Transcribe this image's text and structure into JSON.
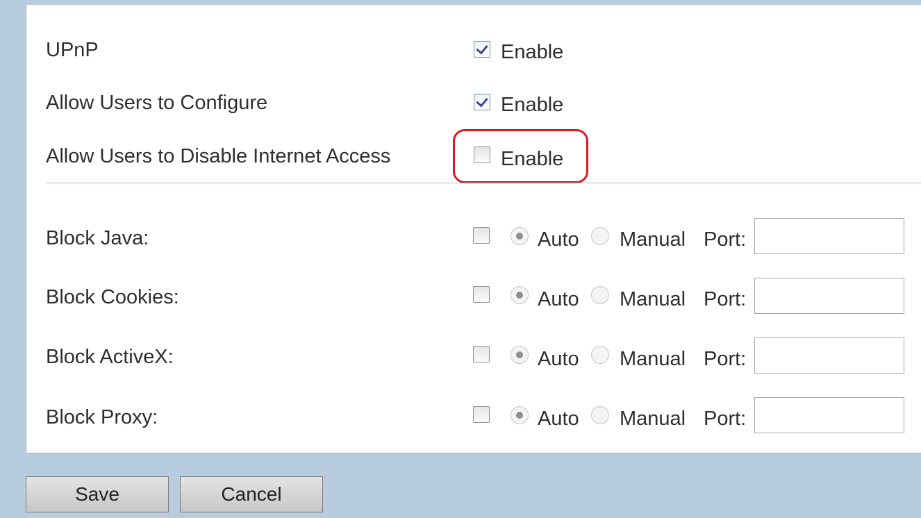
{
  "settings": [
    {
      "label": "UPnP",
      "enable_label": "Enable",
      "checked": true
    },
    {
      "label": "Allow Users to Configure",
      "enable_label": "Enable",
      "checked": true
    },
    {
      "label": "Allow Users to Disable Internet Access",
      "enable_label": "Enable",
      "checked": false
    }
  ],
  "blocks": [
    {
      "label": "Block Java:",
      "auto_label": "Auto",
      "manual_label": "Manual",
      "port_label": "Port:",
      "port_value": ""
    },
    {
      "label": "Block Cookies:",
      "auto_label": "Auto",
      "manual_label": "Manual",
      "port_label": "Port:",
      "port_value": ""
    },
    {
      "label": "Block ActiveX:",
      "auto_label": "Auto",
      "manual_label": "Manual",
      "port_label": "Port:",
      "port_value": ""
    },
    {
      "label": "Block Proxy:",
      "auto_label": "Auto",
      "manual_label": "Manual",
      "port_label": "Port:",
      "port_value": ""
    }
  ],
  "buttons": {
    "save_label": "Save",
    "cancel_label": "Cancel"
  },
  "colors": {
    "highlight": "#e3161f",
    "background": "#b8cce0"
  }
}
